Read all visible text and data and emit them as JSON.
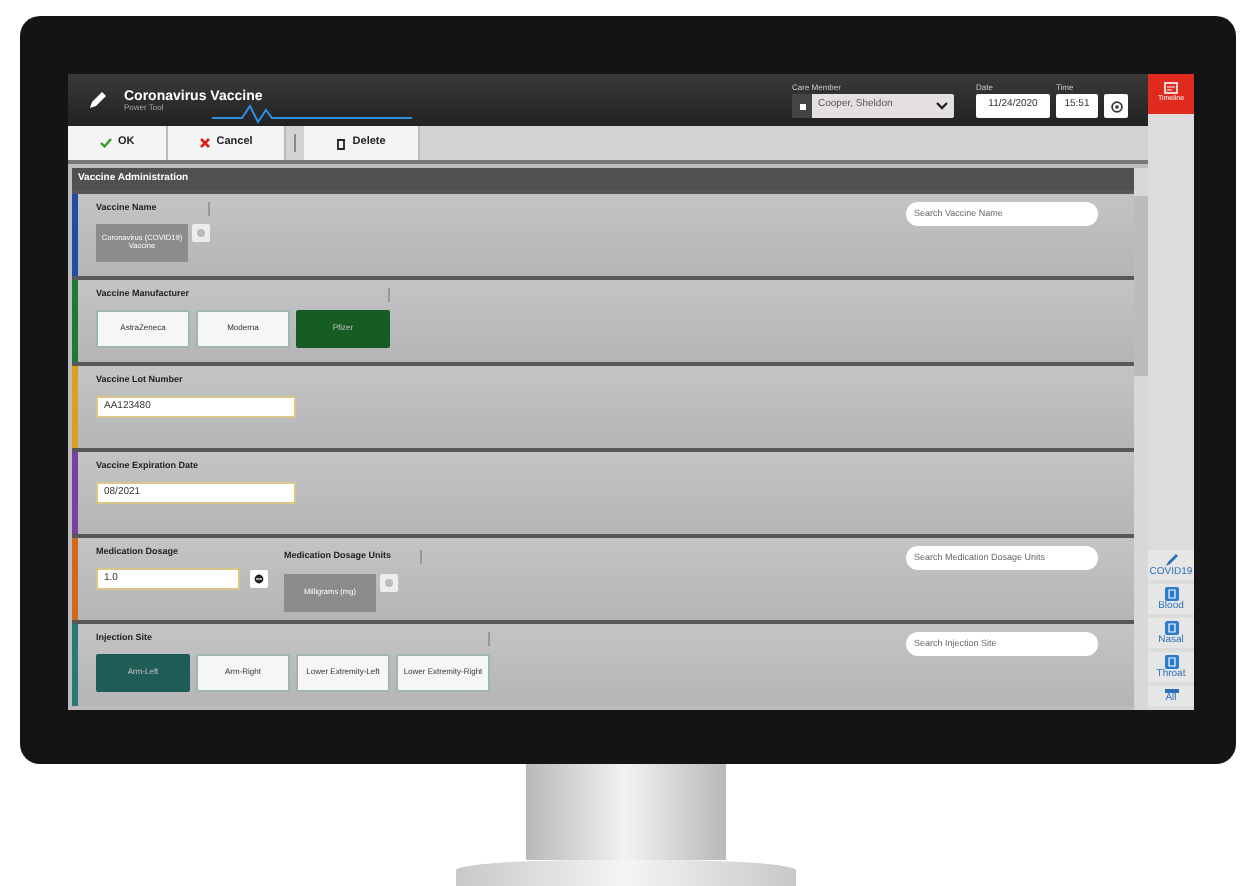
{
  "app": {
    "title": "Coronavirus Vaccine",
    "subtitle": "Power Tool"
  },
  "header_fields": {
    "care_member": {
      "label": "Care Member",
      "value": "Cooper, Sheldon"
    },
    "date": {
      "label": "Date",
      "value": "11/24/2020"
    },
    "time": {
      "label": "Time",
      "value": "15:51"
    }
  },
  "toolbar": [
    {
      "label": "OK",
      "kind": "ok"
    },
    {
      "label": "Cancel",
      "kind": "cancel"
    },
    {
      "label": "Delete",
      "kind": "delete"
    }
  ],
  "timeline_button": {
    "label": "Timeline"
  },
  "section": {
    "title": "Vaccine Administration"
  },
  "rows": [
    {
      "kind": "picker",
      "color": "#1f4fa0",
      "label": "Vaccine Name",
      "chip": "Coronavirus (COVID19) Vaccine",
      "search_placeholder": "Search Vaccine Name"
    },
    {
      "kind": "options",
      "color": "#1e7a2e",
      "label": "Vaccine Manufacturer",
      "options": [
        {
          "label": "AstraZeneca",
          "selected": false
        },
        {
          "label": "Moderna",
          "selected": false
        },
        {
          "label": "Pfizer",
          "selected": true
        }
      ]
    },
    {
      "kind": "text",
      "color": "#d9a21b",
      "label": "Vaccine Lot Number",
      "value": "AA123480"
    },
    {
      "kind": "text",
      "color": "#7b3fa0",
      "label": "Vaccine Expiration Date",
      "value": "08/2021"
    },
    {
      "kind": "dosage",
      "color": "#d06a1a",
      "label": "Medication Dosage",
      "value": "1.0",
      "units_label": "Medication Dosage Units",
      "chip": "Milligrams (mg)",
      "search_placeholder": "Search Medication Dosage Units"
    },
    {
      "kind": "options",
      "color": "#2a7a73",
      "label": "Injection Site",
      "search_placeholder": "Search Injection Site",
      "options": [
        {
          "label": "Arm-Left",
          "selected": true
        },
        {
          "label": "Arm-Right",
          "selected": false
        },
        {
          "label": "Lower Extremity-Left",
          "selected": false
        },
        {
          "label": "Lower Extremity-Right",
          "selected": false
        }
      ]
    }
  ],
  "sidebar_tools": [
    {
      "label": "COVID19",
      "kind": "pencil"
    },
    {
      "label": "Blood",
      "kind": "clipboard"
    },
    {
      "label": "Nasal",
      "kind": "clipboard"
    },
    {
      "label": "Throat",
      "kind": "clipboard"
    },
    {
      "label": "All",
      "kind": "more"
    }
  ]
}
